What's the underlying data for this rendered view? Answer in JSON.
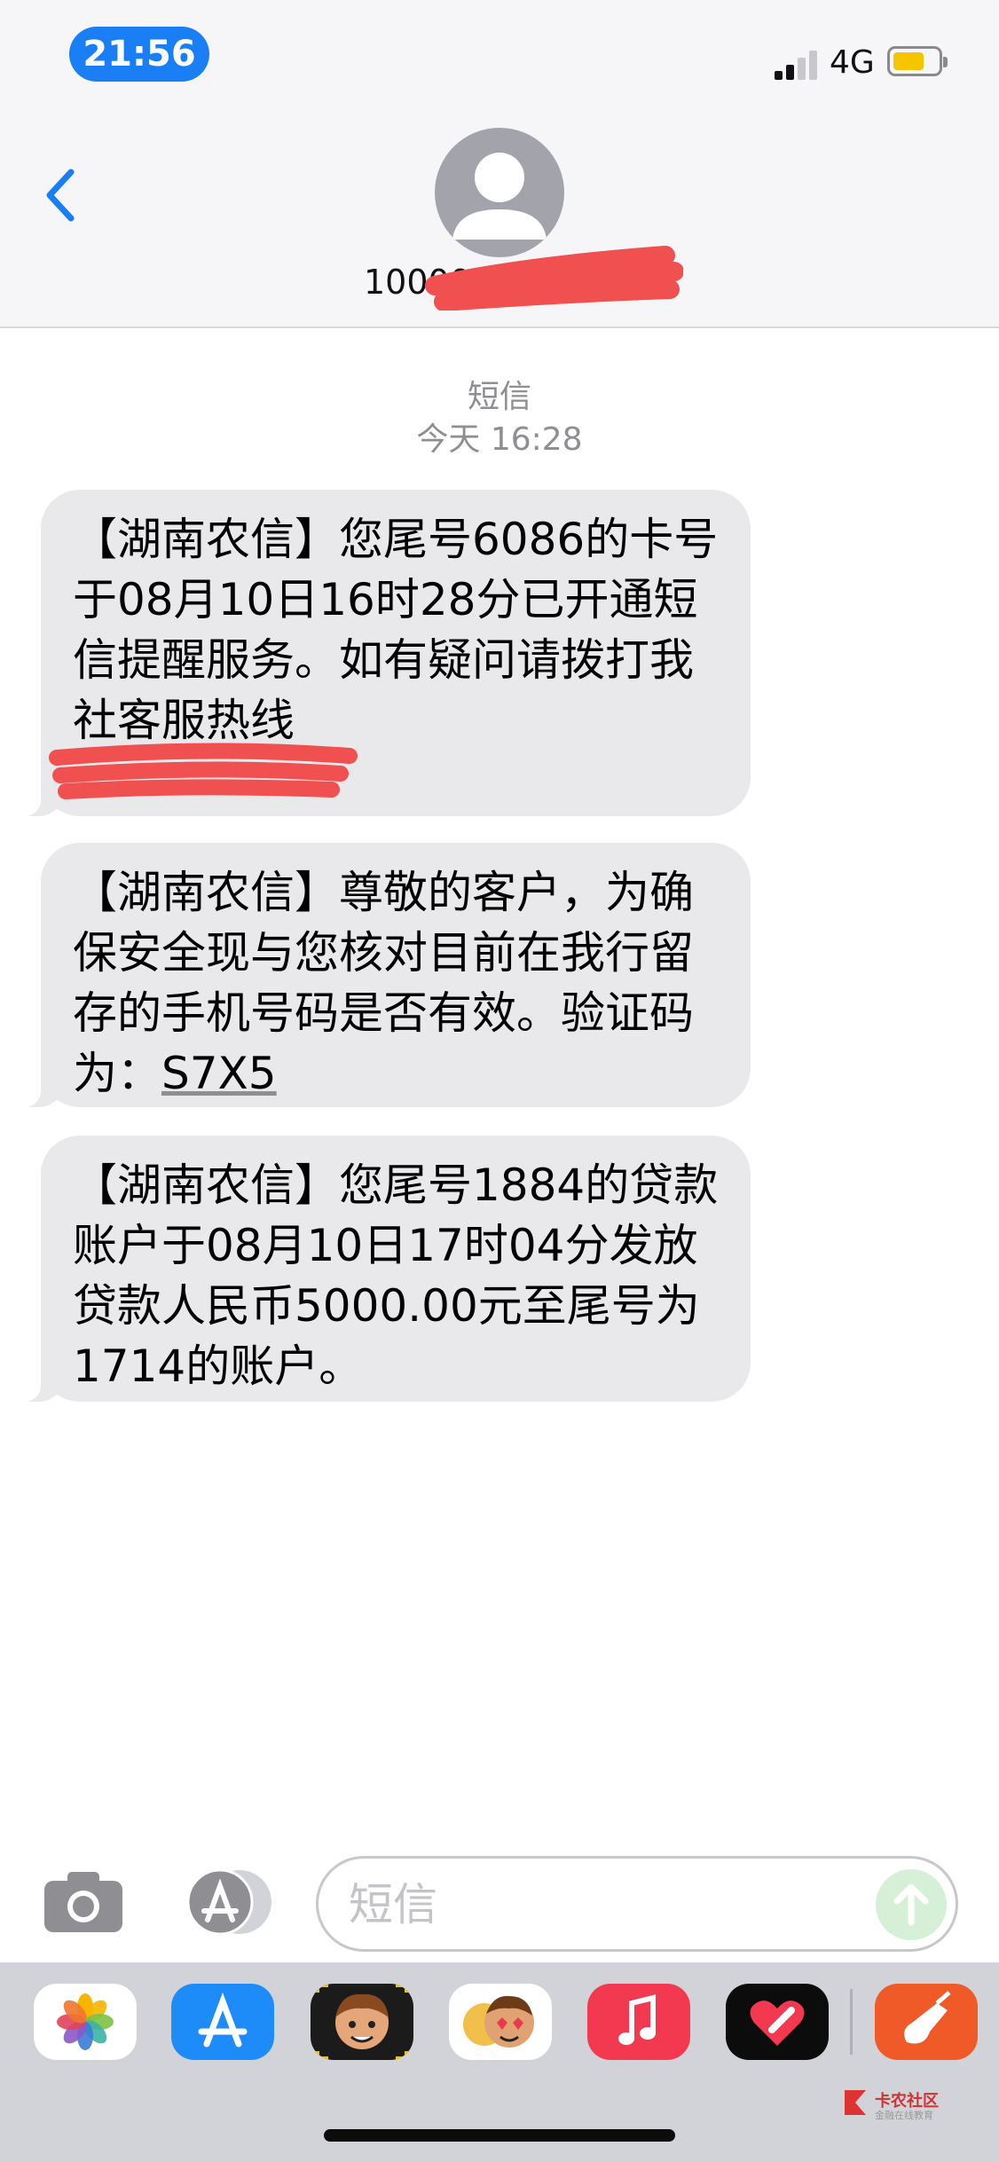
{
  "status_bar": {
    "time": "21:56",
    "network": "4G",
    "battery_color": "#f7c500",
    "time_pill_color": "#1a7ef5"
  },
  "header": {
    "contact_visible": "10000",
    "back_icon": "chevron-left-icon",
    "avatar_icon": "person-icon"
  },
  "conversation": {
    "service_label": "短信",
    "timestamp": "今天 16:28",
    "messages": [
      {
        "text": "【湖南农信】您尾号6086的卡号于08月10日16时28分已开通短信提醒服务。如有疑问请拨打我社客服热线"
      },
      {
        "text": "【湖南农信】尊敬的客户，为确保安全现与您核对目前在我行留存的手机号码是否有效。验证码为：",
        "code": "S7X5"
      },
      {
        "text": "【湖南农信】您尾号1884的贷款账户于08月10日17时04分发放贷款人民币5000.00元至尾号为1714的账户。"
      }
    ]
  },
  "input_bar": {
    "placeholder": "短信",
    "camera_icon": "camera-icon",
    "apps_icon": "app-store-icon",
    "send_icon": "send-arrow-icon"
  },
  "drawer": {
    "apps": [
      "photos-icon",
      "app-store-icon",
      "memoji-icon",
      "memoji-stickers-icon",
      "music-icon",
      "digital-touch-icon",
      "garageband-icon"
    ]
  },
  "watermark": {
    "title": "卡农社区",
    "subtitle": "金融在线教育"
  }
}
